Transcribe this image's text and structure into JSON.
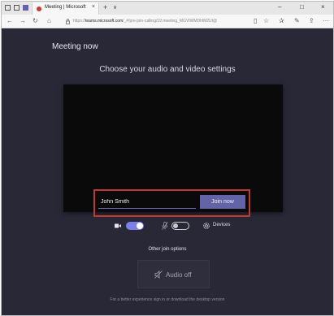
{
  "browser": {
    "tab_title": "Meeting | Microsoft",
    "tab_close": "×",
    "new_tab": "+",
    "tab_menu": "∨",
    "url_prefix": "https://",
    "url_domain": "teams.microsoft.com",
    "url_path": "/_#/pre-join-calling/19:meeting_MGVIWMDhlM2Ut@",
    "window_minimize": "–",
    "window_maximize": "□",
    "window_close": "×",
    "nav_back": "←",
    "nav_forward": "→",
    "nav_refresh": "↻",
    "nav_home": "⌂",
    "toolbar_reading": "▯",
    "toolbar_favorite": "☆",
    "toolbar_favorites_hub": "✰",
    "toolbar_pen": "✎",
    "toolbar_share": "⇪",
    "toolbar_more": "···"
  },
  "page": {
    "meeting_title": "Meeting now",
    "heading": "Choose your audio and video settings",
    "name_value": "John Smith",
    "join_button": "Join now",
    "devices_label": "Devices",
    "other_options": "Other join options",
    "audio_off_label": "Audio off",
    "footer": "For a better experience sign in or download the desktop version"
  },
  "state": {
    "camera_on": true,
    "mic_on": false
  },
  "colors": {
    "background": "#292836",
    "accent": "#6264a7",
    "toggle_on": "#7b7fe8",
    "highlight": "#c2382d",
    "recording": "#d6342f"
  }
}
